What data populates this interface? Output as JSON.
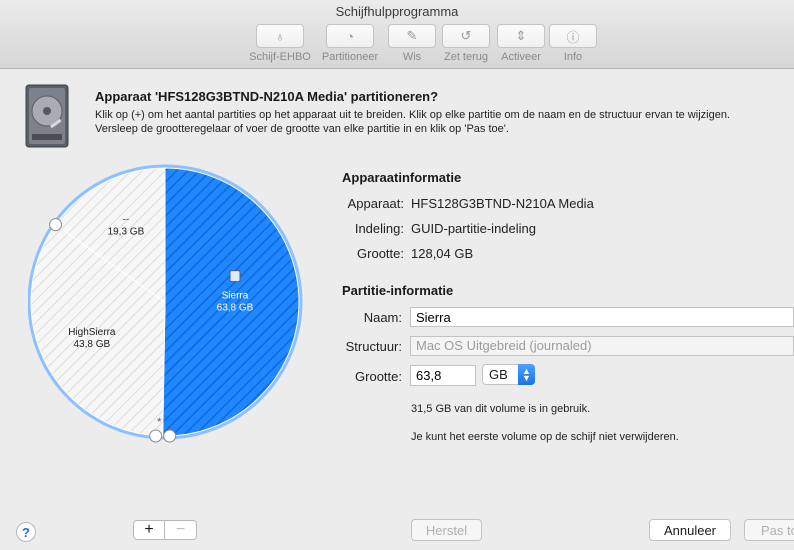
{
  "window": {
    "title": "Schijfhulpprogramma"
  },
  "toolbar": [
    {
      "name": "tool-schijf-ehbo",
      "icon": "stethoscope-icon",
      "glyph": "♁",
      "label": "Schijf-EHBO"
    },
    {
      "name": "tool-partitioneer",
      "icon": "pie-icon",
      "glyph": "◔",
      "label": "Partitioneer"
    },
    {
      "name": "tool-wis",
      "icon": "erase-icon",
      "glyph": "✎",
      "label": "Wis"
    },
    {
      "name": "tool-zet-terug",
      "icon": "restore-icon",
      "glyph": "↺",
      "label": "Zet terug"
    },
    {
      "name": "tool-activeer",
      "icon": "eject-icon",
      "glyph": "⇕",
      "label": "Activeer"
    },
    {
      "name": "tool-info",
      "icon": "info-icon",
      "glyph": "ⓘ",
      "label": "Info"
    }
  ],
  "header": {
    "title": "Apparaat 'HFS128G3BTND-N210A Media' partitioneren?",
    "desc1": "Klik op (+) om het aantal partities op het apparaat uit te breiden. Klik op elke partitie om de naam en de structuur ervan te wijzigen.",
    "desc2": "Versleep de grootteregelaar of voer de grootte van elke partitie in en klik op 'Pas toe'."
  },
  "pie": {
    "slices": [
      {
        "name": "Sierra",
        "size": "63,8 GB",
        "value": 63.8,
        "selected": true
      },
      {
        "name": "HighSierra",
        "size": "43,8 GB",
        "value": 43.8,
        "selected": false
      },
      {
        "name": "--",
        "size": "19,3 GB",
        "value": 19.3,
        "selected": false
      }
    ],
    "free_marker": "*",
    "colors": {
      "selected": "#1f87ff",
      "selected_dark": "#1774e8",
      "other": "#f7f7f7",
      "rim": "#8cc0ff"
    }
  },
  "device_info": {
    "title": "Apparaatinformatie",
    "rows": [
      {
        "label": "Apparaat:",
        "value": "HFS128G3BTND-N210A Media"
      },
      {
        "label": "Indeling:",
        "value": "GUID-partitie-indeling"
      },
      {
        "label": "Grootte:",
        "value": "128,04 GB"
      }
    ]
  },
  "partition_info": {
    "title": "Partitie-informatie",
    "name_label": "Naam:",
    "name_value": "Sierra",
    "format_label": "Structuur:",
    "format_value": "Mac OS Uitgebreid (journaled)",
    "size_label": "Grootte:",
    "size_value": "63,8",
    "unit_value": "GB",
    "note_usage": "31,5 GB van dit volume is in gebruik.",
    "note_remove": "Je kunt het eerste volume op de schijf niet verwijderen."
  },
  "footer": {
    "help": "?",
    "add": "+",
    "remove": "−",
    "revert": "Herstel",
    "cancel": "Annuleer",
    "apply": "Pas toe"
  }
}
